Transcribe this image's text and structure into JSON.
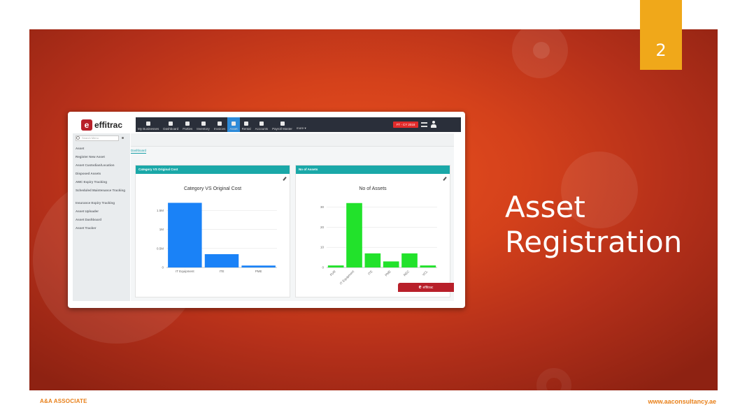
{
  "slide": {
    "number": "2",
    "title_line1": "Asset",
    "title_line2": "Registration",
    "footer_left": "A&A ASSOCIATE",
    "footer_right": "www.aaconsultancy.ae",
    "colors": {
      "accent_orange": "#f0a81a",
      "footer_text": "#e8801a"
    }
  },
  "app": {
    "logo_mark": "e",
    "logo_text": "effitrac",
    "nav": [
      {
        "label": "My Businesses",
        "icon": "briefcase-icon"
      },
      {
        "label": "Dashboard",
        "icon": "dashboard-icon"
      },
      {
        "label": "Parties",
        "icon": "people-icon"
      },
      {
        "label": "Inventory",
        "icon": "inventory-icon"
      },
      {
        "label": "Invoices",
        "icon": "invoice-icon"
      },
      {
        "label": "Asset",
        "icon": "asset-icon"
      },
      {
        "label": "Rental",
        "icon": "rental-icon"
      },
      {
        "label": "Accounts",
        "icon": "accounts-icon"
      },
      {
        "label": "Payroll Master",
        "icon": "user-icon"
      },
      {
        "label": "more ▾",
        "icon": ""
      }
    ],
    "active_nav": "Asset",
    "fy_badge": "FT - CY 2018",
    "search_placeholder": "Search Menu",
    "sidebar": [
      "Asset",
      "Register New Asset",
      "Asset Custodian/Location",
      "Disposed Assets",
      "AMC Expiry Tracking",
      "Scheduled Maintenance Tracking",
      "Insurance Expiry Tracking",
      "Asset Uploader",
      "Asset Dashboard",
      "Asset Tracker"
    ],
    "dashboard_tab": "Dashboard",
    "footer_logo": "effitrac"
  },
  "chart_data": [
    {
      "type": "bar",
      "panel_header": "Category VS Original Cost",
      "title": "Category VS Original Cost",
      "categories": [
        "IT Equipment",
        "ITE",
        "PME"
      ],
      "values": [
        1.7,
        0.35,
        0.05
      ],
      "ytick_labels": [
        "0",
        "0.5M",
        "1M",
        "1.5M"
      ],
      "ytick_values": [
        0,
        0.5,
        1,
        1.5
      ],
      "ylim": [
        0,
        1.8
      ],
      "color": "#1a82f7",
      "grid": true
    },
    {
      "type": "bar",
      "panel_header": "No of Assets",
      "title": "No of Assets",
      "categories": [
        "FUR",
        "IT Equipment",
        "ITE",
        "PME",
        "REC",
        "VCL"
      ],
      "values": [
        1,
        32,
        7,
        3,
        7,
        1
      ],
      "ytick_labels": [
        "0",
        "10",
        "20",
        "30"
      ],
      "ytick_values": [
        0,
        10,
        20,
        30
      ],
      "ylim": [
        0,
        34
      ],
      "color": "#22e22b",
      "grid": true
    }
  ]
}
